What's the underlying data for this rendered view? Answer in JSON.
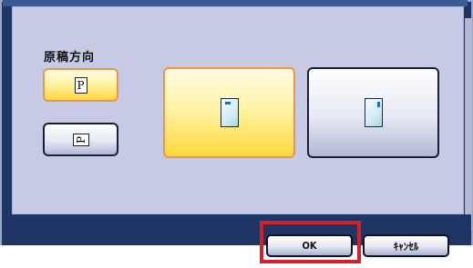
{
  "panel": {
    "section_label": "原稿方向"
  },
  "orientation_small": [
    {
      "label": "P",
      "selected": true
    },
    {
      "label": "P",
      "selected": false
    }
  ],
  "orientation_large": [
    {
      "name": "portrait-document",
      "selected": true
    },
    {
      "name": "landscape-document",
      "selected": false
    }
  ],
  "footer": {
    "ok_label": "OK",
    "cancel_label": "ｷｬﾝｾﾙ"
  },
  "colors": {
    "frame": "#1f3566",
    "panel": "#c6cae4",
    "selected_fill": "#ffd93a",
    "selected_border": "#f29440",
    "highlight": "#d4202a"
  }
}
